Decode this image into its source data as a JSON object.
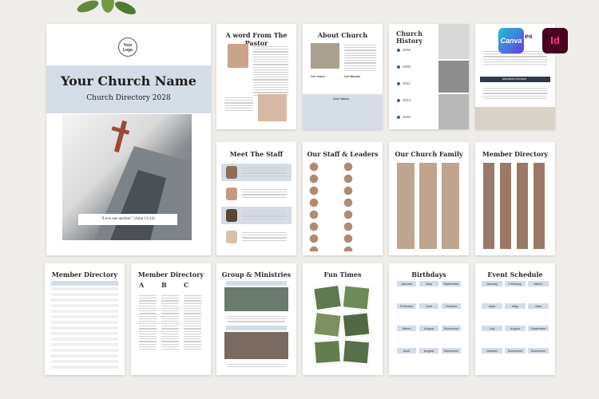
{
  "cover": {
    "logo": "Your Logo",
    "church_name": "Your Church Name",
    "subtitle": "Church Directory 2028",
    "quote": "“Love one another.” (John 13:34)"
  },
  "badges": {
    "canva": "Canva",
    "indesign": "Id"
  },
  "pages": {
    "pastor": "A word From The Pastor",
    "about": "About Church",
    "about_vision": "Our Vision",
    "about_mission": "Our Mission",
    "about_core": "Core Values",
    "history": "Church History",
    "history_years": [
      "2005",
      "2008",
      "2021",
      "2024",
      "2026"
    ],
    "services_partial": "es",
    "services_midweek": "Mid-Week Services",
    "staff": "Meet The Staff",
    "staff_leaders": "Our Staff & Leaders",
    "family": "Our Church Family",
    "member_dir_1": "Member Directory",
    "member_dir_2": "Member Directory",
    "member_dir_3": "Member Directory",
    "letters": [
      "A",
      "B",
      "C"
    ],
    "groups": "Group & Ministries",
    "fun": "Fun Times",
    "birthdays": "Birthdays",
    "events": "Event Schedule",
    "months": [
      "January",
      "February",
      "March",
      "April",
      "May",
      "June",
      "July",
      "August",
      "September",
      "October",
      "November",
      "December"
    ]
  },
  "colors": {
    "accent": "#d4dde5",
    "dark_blue": "#3e5f80",
    "background": "#efedea"
  }
}
